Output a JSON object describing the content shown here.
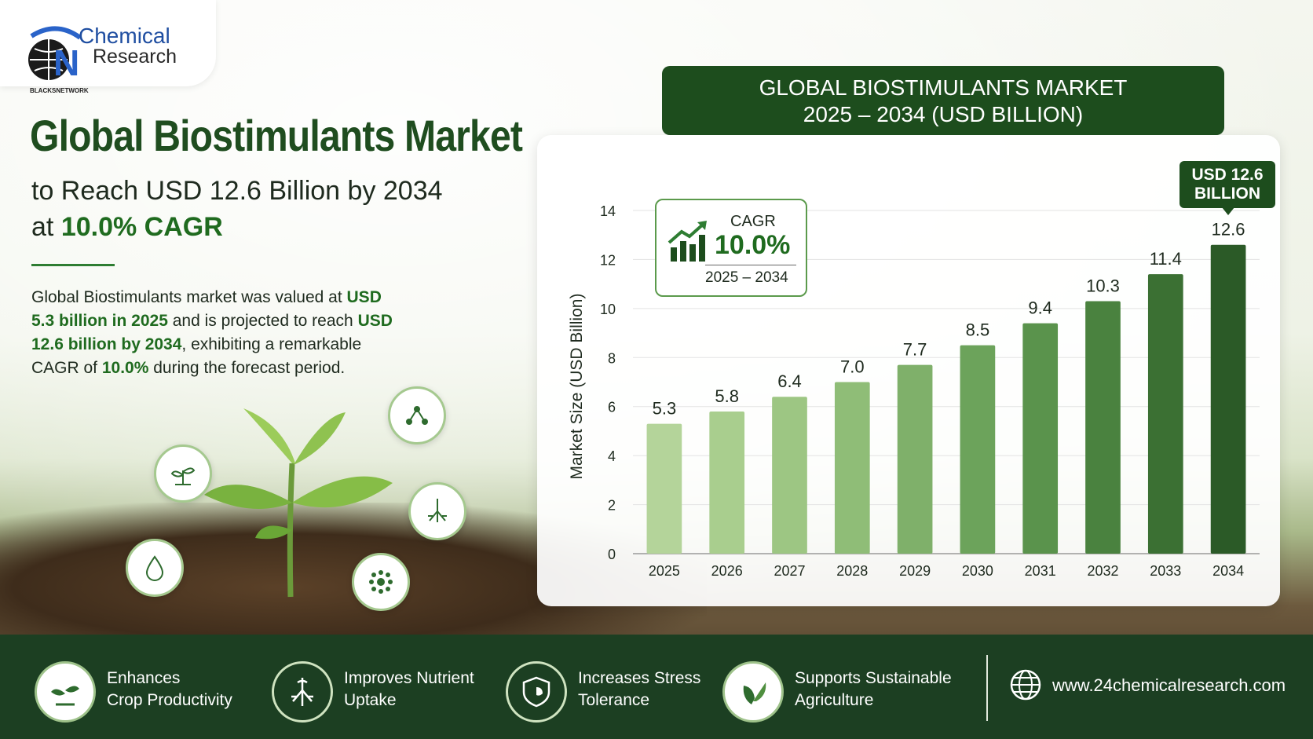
{
  "brand": {
    "logo_line1": "Chemical",
    "logo_line2": "Research",
    "logo_sub": "BLACKSNETWORK"
  },
  "intro": {
    "headline": "Global Biostimulants Market",
    "subline1": "to Reach USD 12.6 Billion by 2034",
    "subline2_prefix": "at ",
    "subline2_highlight": "10.0% CAGR",
    "para": {
      "p1": "Global Biostimulants market was valued at ",
      "b1": "USD 5.3 billion in 2025",
      "p2": " and is projected to reach ",
      "b2": "USD 12.6 billion by 2034",
      "p3": ", exhibiting a remarkable CAGR of ",
      "b3": "10.0%",
      "p4": " during the forecast period."
    }
  },
  "chart_header": {
    "line1": "GLOBAL BIOSTIMULANTS MARKET",
    "line2": "2025 – 2034 (USD BILLION)"
  },
  "cagr_box": {
    "label": "CAGR",
    "value": "10.0%",
    "period": "2025 – 2034"
  },
  "callout": {
    "line1": "USD 12.6",
    "line2": "BILLION"
  },
  "chart_data": {
    "type": "bar",
    "title": "GLOBAL BIOSTIMULANTS MARKET 2025 – 2034 (USD BILLION)",
    "categories": [
      "2025",
      "2026",
      "2027",
      "2028",
      "2029",
      "2030",
      "2031",
      "2032",
      "2033",
      "2034"
    ],
    "values": [
      5.3,
      5.8,
      6.4,
      7.0,
      7.7,
      8.5,
      9.4,
      10.3,
      11.4,
      12.6
    ],
    "data_labels": [
      "5.3",
      "5.8",
      "6.4",
      "7.0",
      "7.7",
      "8.5",
      "9.4",
      "10.3",
      "11.4",
      "12.6"
    ],
    "xlabel": "",
    "ylabel": "Market Size (USD Billion)",
    "ylim": [
      0,
      14
    ],
    "yticks": [
      0,
      2,
      4,
      6,
      8,
      10,
      12,
      14
    ],
    "grid": true,
    "legend": "none",
    "colors": [
      "#b4d49a",
      "#a9ce8e",
      "#9dc683",
      "#8fbd77",
      "#7fb06a",
      "#6ca35b",
      "#5a934c",
      "#4a823f",
      "#3b7033",
      "#2b5a27"
    ]
  },
  "features": [
    {
      "line1": "Enhances",
      "line2": "Crop Productivity",
      "icon": "sprout-icon"
    },
    {
      "line1": "Improves Nutrient",
      "line2": "Uptake",
      "icon": "roots-icon"
    },
    {
      "line1": "Increases Stress",
      "line2": "Tolerance",
      "icon": "shield-leaf-icon"
    },
    {
      "line1": "Supports Sustainable",
      "line2": "Agriculture",
      "icon": "leaves-icon"
    }
  ],
  "website": "www.24chemicalresearch.com",
  "colors": {
    "brand_green": "#1d4d1d",
    "accent_green": "#1f6b1f",
    "footer": "#1c3f22"
  }
}
